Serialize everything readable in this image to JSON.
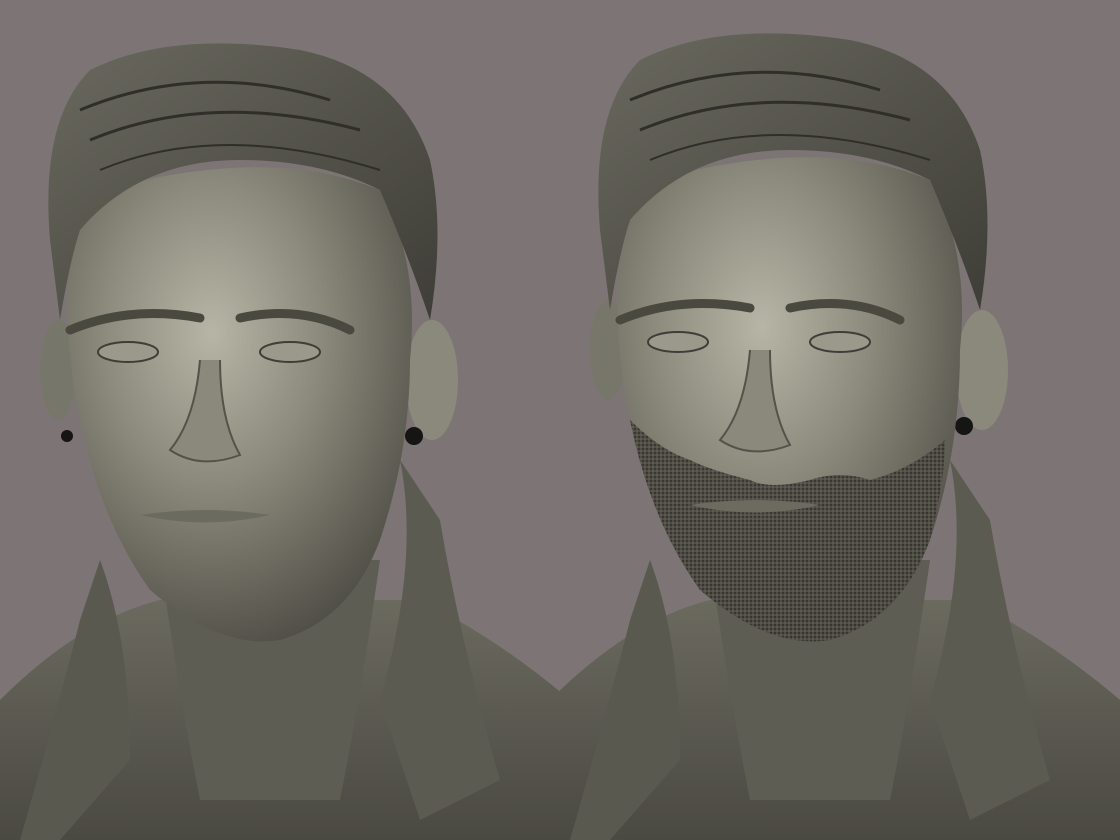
{
  "scene": {
    "background_color": "#7d7575",
    "clay_color": "#7b7a6e",
    "busts": [
      {
        "id": "clean-shaven",
        "beard": false,
        "earring": true
      },
      {
        "id": "bearded",
        "beard": true,
        "earring": true
      }
    ]
  }
}
